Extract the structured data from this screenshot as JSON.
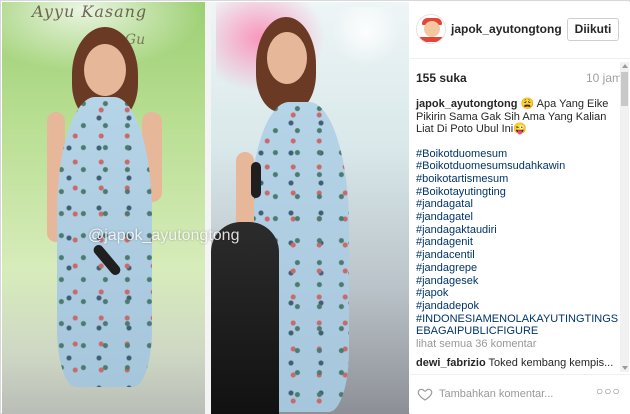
{
  "post": {
    "photo_banner_1": "Ayyu Kasang",
    "photo_banner_2": "k Gu",
    "watermark": "@japok_ayutongtong"
  },
  "header": {
    "username": "japok_ayutongtong",
    "follow_label": "Diikuti"
  },
  "stats": {
    "likes": "155 suka",
    "time": "10 jam"
  },
  "caption": {
    "user": "japok_ayutongtong",
    "text": "😩 Apa Yang Eike Pikirin Sama Gak Sih Ama Yang Kalian Liat Di Poto Ubul Ini😜"
  },
  "hashtags": [
    "#Boikotduomesum",
    "#Boikotduomesumsudahkawin",
    "#boikotartismesum",
    "#Boikotayutingting",
    "#jandagatal",
    "#jandagatel",
    "#jandagaktaudiri",
    "#jandagenit",
    "#jandacentil",
    "#jandagrepe",
    "#jandagesek",
    "#japok",
    "#jandadepok",
    "#INDONESIAMENOLAKAYUTINGTINGSEBAGAIPUBLICFIGURE"
  ],
  "comments": {
    "view_all": "lihat semua 36 komentar",
    "first_user": "dewi_fabrizio",
    "first_text": "Toked kembang kempis..."
  },
  "footer": {
    "add_comment_placeholder": "Tambahkan komentar...",
    "more": "○○○"
  },
  "icons": {
    "like": "heart-icon",
    "more": "more-options-icon"
  },
  "colors": {
    "hashtag": "#003569",
    "muted": "#999999"
  }
}
